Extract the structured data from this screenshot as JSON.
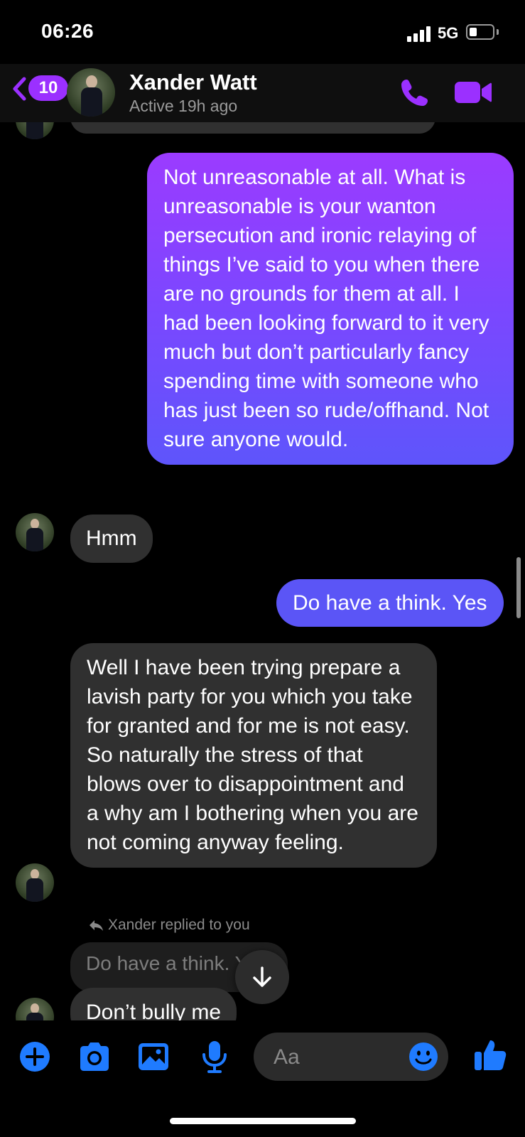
{
  "status_bar": {
    "time": "06:26",
    "network": "5G"
  },
  "header": {
    "back_count": "10",
    "contact_name": "Xander Watt",
    "contact_status": "Active 19h ago"
  },
  "messages": {
    "sent_long": "Not unreasonable at all. What is unreasonable is your wanton persecution and ironic relaying of things I’ve said to you when there are no grounds for them at all. I had been looking forward to it very much but don’t particularly fancy spending time with someone who has just been so rude/offhand. Not sure anyone would.",
    "received_hmm": "Hmm",
    "sent_short": "Do have a think. Yes",
    "received_long": "Well I have been trying prepare a lavish party for you which you take for granted and for me is not easy. So naturally the stress of that blows over to disappointment and a why am I bothering when you are not coming anyway feeling.",
    "reply_label": "Xander replied to you",
    "quoted_text": "Do have a think. Yes",
    "received_bully": "Don’t bully me"
  },
  "composer": {
    "placeholder": "Aa"
  },
  "colors": {
    "accent_purple": "#9b30ff",
    "icon_blue": "#1f7bff",
    "sent_gradient_top": "#9b3bff",
    "sent_gradient_bottom": "#5e55fb",
    "sent_blue": "#5b55f6",
    "received_bubble": "#303030"
  },
  "icons": [
    "signal-icon",
    "battery-icon",
    "back-chevron-icon",
    "phone-icon",
    "video-camera-icon",
    "reply-arrow-icon",
    "arrow-down-icon",
    "plus-icon",
    "camera-icon",
    "image-icon",
    "microphone-icon",
    "emoji-icon",
    "thumbs-up-icon"
  ]
}
